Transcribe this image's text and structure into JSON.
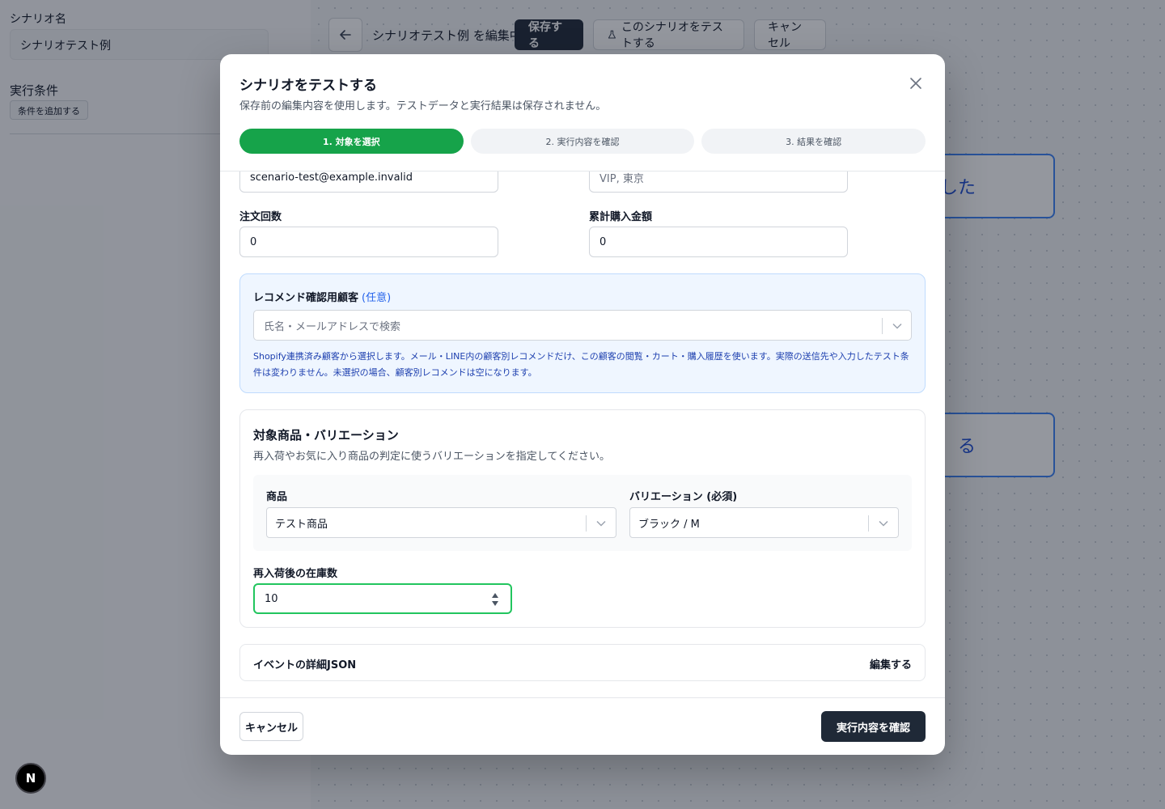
{
  "background": {
    "sidebar": {
      "scenario_name_label": "シナリオ名",
      "scenario_name_value": "シナリオテスト例",
      "conditions_label": "実行条件",
      "add_condition_label": "条件を追加する"
    },
    "header": {
      "editing_text": "シナリオテスト例 を編集中",
      "save_label": "保存する",
      "test_label": "このシナリオをテストする",
      "cancel_label": "キャンセル"
    },
    "nodes": [
      {
        "partial_text": "した"
      },
      {
        "partial_text": "る"
      }
    ]
  },
  "modal": {
    "title": "シナリオをテストする",
    "subtitle": "保存前の編集内容を使用します。テストデータと実行結果は保存されません。",
    "steps": [
      {
        "label": "1. 対象を選択",
        "active": true
      },
      {
        "label": "2. 実行内容を確認",
        "active": false
      },
      {
        "label": "3. 結果を確認",
        "active": false
      }
    ],
    "fields": {
      "email_value": "scenario-test@example.invalid",
      "tags_placeholder": "VIP, 東京",
      "order_count_label": "注文回数",
      "order_count_value": "0",
      "total_spent_label": "累計購入金額",
      "total_spent_value": "0"
    },
    "recommend": {
      "title": "レコメンド確認用顧客",
      "optional": "(任意)",
      "placeholder": "氏名・メールアドレスで検索",
      "help": "Shopify連携済み顧客から選択します。メール・LINE内の顧客別レコメンドだけ、この顧客の閲覧・カート・購入履歴を使います。実際の送信先や入力したテスト条件は変わりません。未選択の場合、顧客別レコメンドは空になります。"
    },
    "product": {
      "title": "対象商品・バリエーション",
      "subtitle": "再入荷やお気に入り商品の判定に使うバリエーションを指定してください。",
      "product_label": "商品",
      "product_value": "テスト商品",
      "variant_label": "バリエーション (必須)",
      "variant_value": "ブラック / M",
      "stock_label": "再入荷後の在庫数",
      "stock_value": "10"
    },
    "json": {
      "label": "イベントの詳細JSON",
      "edit_label": "編集する"
    },
    "footer": {
      "cancel_label": "キャンセル",
      "confirm_label": "実行内容を確認"
    }
  },
  "next_badge": "N",
  "colors": {
    "accent_green": "#16a34a",
    "primary_dark": "#1f2937",
    "info_blue": "#2563eb"
  }
}
